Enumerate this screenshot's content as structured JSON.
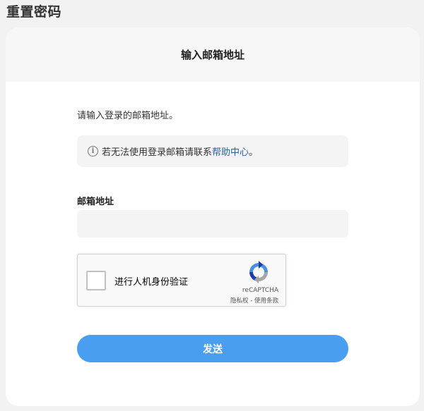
{
  "page": {
    "title": "重置密码"
  },
  "card": {
    "header": "输入邮箱地址"
  },
  "form": {
    "instruction": "请输入登录的邮箱地址。",
    "notice_text": "若无法使用登录邮箱请联系",
    "notice_link": "帮助中心",
    "notice_suffix": "。",
    "email_label": "邮箱地址",
    "email_value": "",
    "email_placeholder": "",
    "send_label": "发送"
  },
  "recaptcha": {
    "label": "进行人机身份验证",
    "brand": "reCAPTCHA",
    "privacy": "隐私权",
    "separator": " - ",
    "terms": "使用条款"
  },
  "colors": {
    "accent": "#4a9ef0",
    "link": "#2b5f9e",
    "background": "#f2f2f2"
  },
  "icons": [
    "info-icon",
    "recaptcha-logo-icon"
  ]
}
